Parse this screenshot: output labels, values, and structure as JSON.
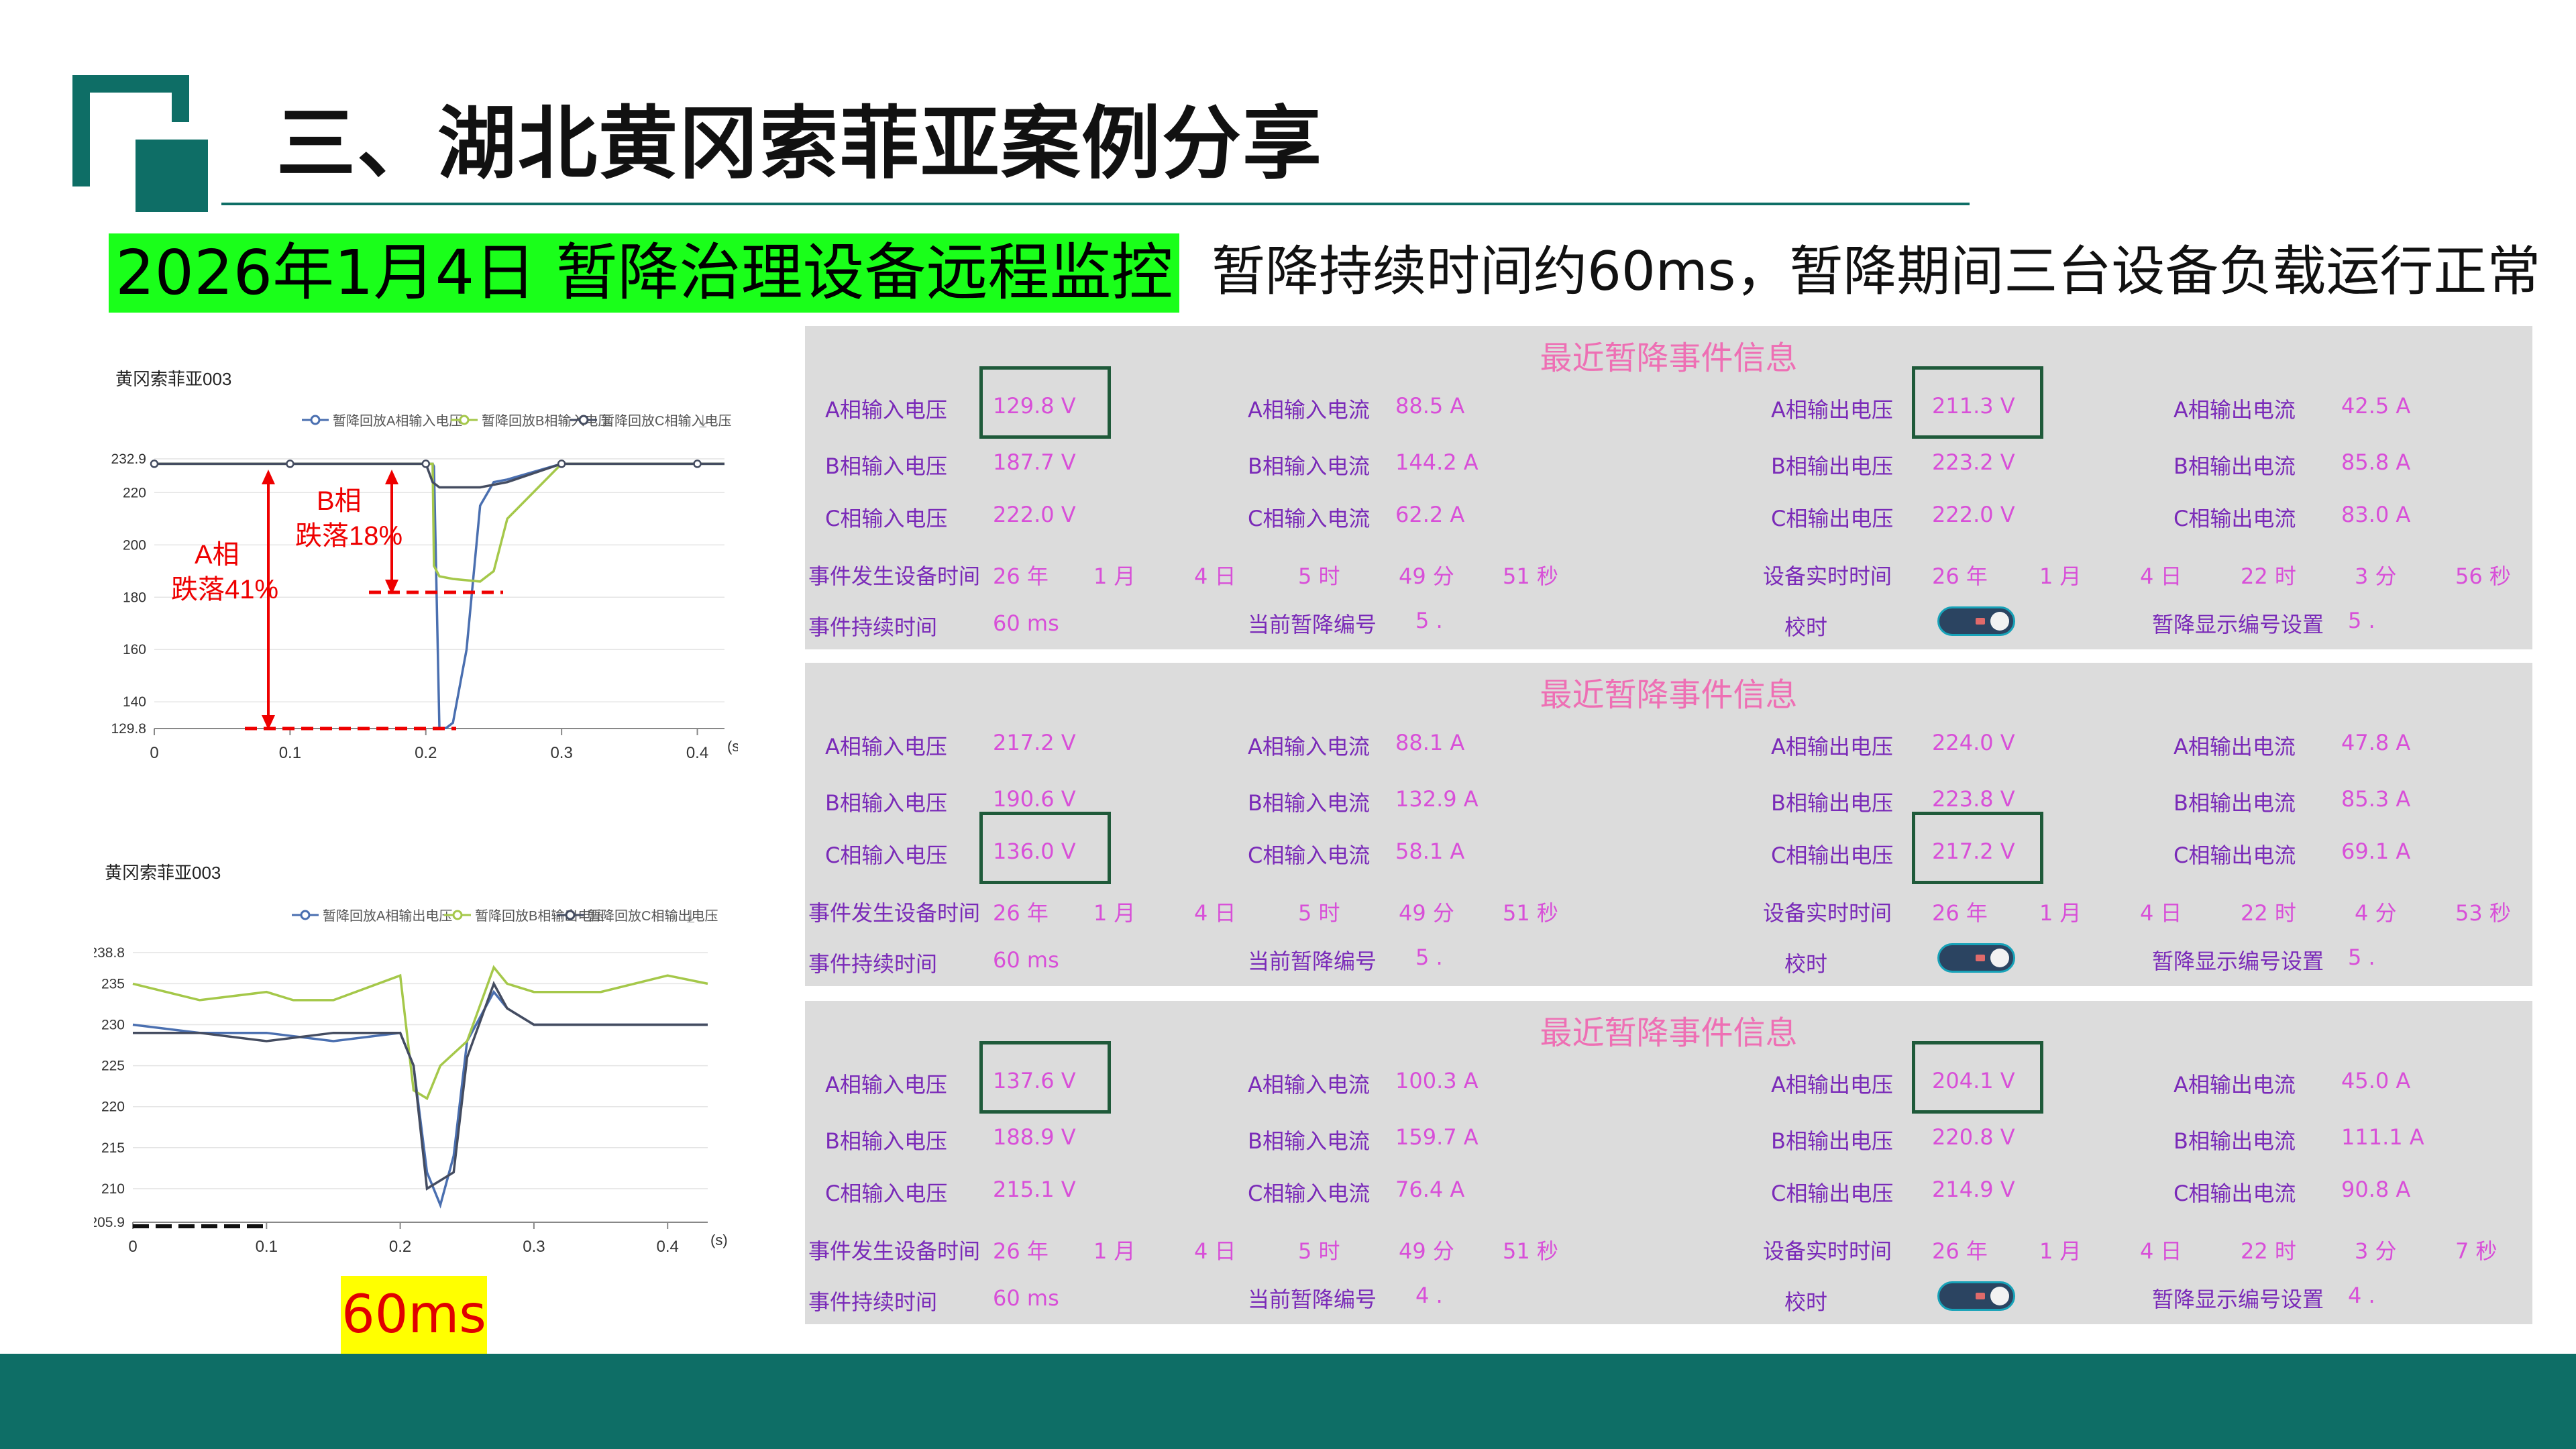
{
  "header": {
    "title": "三、湖北黄冈索菲亚案例分享",
    "subtitle": "2026年1月4日 暂降治理设备远程监控",
    "note": "暂降持续时间约60ms，暂降期间三台设备负载运行正常"
  },
  "colors": {
    "accent": "#0e6e66",
    "subtitle_bg": "#1aff1a",
    "label": "#7a2ab8",
    "value": "#d84fd8",
    "panel_title": "#ee6fb4"
  },
  "chart1": {
    "title": "黄冈索菲亚003",
    "legend": [
      "暂降回放A相输入电压",
      "暂降回放B相输入电压",
      "暂降回放C相输入电压"
    ],
    "y_ticks": [
      "232.9",
      "220",
      "200",
      "180",
      "160",
      "140",
      "129.8"
    ],
    "x_ticks": [
      "0",
      "0.1",
      "0.2",
      "0.3",
      "0.4",
      "(s)"
    ],
    "annot_a": [
      "A相",
      "跌落41%"
    ],
    "annot_b": [
      "B相",
      "跌落18%"
    ]
  },
  "chart2": {
    "title": "黄冈索菲亚003",
    "legend": [
      "暂降回放A相输出电压",
      "暂降回放B相输出电压",
      "暂降回放C相输出电压"
    ],
    "y_ticks": [
      "238.8",
      "235",
      "230",
      "225",
      "220",
      "215",
      "210",
      "205.9"
    ],
    "x_ticks": [
      "0",
      "0.1",
      "0.2",
      "0.3",
      "0.4",
      "(s)"
    ]
  },
  "duration_label": "60ms",
  "chart_data": [
    {
      "type": "line",
      "title": "黄冈索菲亚003",
      "xlabel": "(s)",
      "ylim": [
        129.8,
        232.9
      ],
      "xlim": [
        0,
        0.42
      ],
      "series": [
        {
          "name": "暂降回放A相输入电压",
          "x": [
            0,
            0.1,
            0.2,
            0.205,
            0.206,
            0.21,
            0.215,
            0.22,
            0.23,
            0.24,
            0.25,
            0.26,
            0.3,
            0.42
          ],
          "y": [
            231,
            231,
            231,
            231,
            230,
            130,
            130,
            132,
            160,
            215,
            224,
            225,
            231,
            231
          ]
        },
        {
          "name": "暂降回放B相输入电压",
          "x": [
            0,
            0.1,
            0.2,
            0.205,
            0.206,
            0.21,
            0.22,
            0.24,
            0.25,
            0.26,
            0.3,
            0.42
          ],
          "y": [
            231,
            231,
            231,
            231,
            192,
            188,
            187,
            186,
            190,
            210,
            231,
            231
          ]
        },
        {
          "name": "暂降回放C相输入电压",
          "x": [
            0,
            0.1,
            0.2,
            0.205,
            0.21,
            0.22,
            0.24,
            0.26,
            0.3,
            0.42
          ],
          "y": [
            231,
            231,
            231,
            224,
            222,
            222,
            222,
            224,
            231,
            231
          ]
        }
      ]
    },
    {
      "type": "line",
      "title": "黄冈索菲亚003",
      "xlabel": "(s)",
      "ylim": [
        205.9,
        238.8
      ],
      "xlim": [
        0,
        0.43
      ],
      "series": [
        {
          "name": "暂降回放A相输出电压",
          "x": [
            0,
            0.05,
            0.1,
            0.15,
            0.2,
            0.21,
            0.22,
            0.23,
            0.24,
            0.25,
            0.27,
            0.28,
            0.3,
            0.35,
            0.4,
            0.43
          ],
          "y": [
            230,
            229,
            229,
            228,
            229,
            225,
            212,
            208,
            214,
            228,
            234,
            232,
            230,
            230,
            230,
            230
          ]
        },
        {
          "name": "暂降回放B相输出电压",
          "x": [
            0,
            0.05,
            0.1,
            0.12,
            0.15,
            0.2,
            0.21,
            0.22,
            0.23,
            0.25,
            0.27,
            0.28,
            0.3,
            0.35,
            0.4,
            0.43
          ],
          "y": [
            235,
            233,
            234,
            233,
            233,
            236,
            222,
            221,
            225,
            228,
            237,
            235,
            234,
            234,
            236,
            235
          ]
        },
        {
          "name": "暂降回放C相输出电压",
          "x": [
            0,
            0.05,
            0.1,
            0.15,
            0.2,
            0.21,
            0.22,
            0.23,
            0.24,
            0.25,
            0.27,
            0.28,
            0.3,
            0.35,
            0.4,
            0.43
          ],
          "y": [
            229,
            229,
            228,
            229,
            229,
            225,
            210,
            211,
            212,
            226,
            235,
            232,
            230,
            230,
            230,
            230
          ]
        }
      ]
    }
  ],
  "panels": [
    {
      "title": "最近暂降事件信息",
      "rows": [
        [
          "A相输入电压",
          "129.8 V",
          "A相输入电流",
          "88.5 A",
          "A相输出电压",
          "211.3 V",
          "A相输出电流",
          "42.5 A"
        ],
        [
          "B相输入电压",
          "187.7 V",
          "B相输入电流",
          "144.2 A",
          "B相输出电压",
          "223.2 V",
          "B相输出电流",
          "85.8 A"
        ],
        [
          "C相输入电压",
          "222.0 V",
          "C相输入电流",
          "62.2 A",
          "C相输出电压",
          "222.0 V",
          "C相输出电流",
          "83.0 A"
        ]
      ],
      "event_label": "事件发生设备时间",
      "event_time": [
        "26 年",
        "1 月",
        "4 日",
        "5 时",
        "49 分",
        "51 秒"
      ],
      "rt_label": "设备实时时间",
      "rt_time": [
        "26 年",
        "1 月",
        "4 日",
        "22 时",
        "3 分",
        "56 秒"
      ],
      "dur_label": "事件持续时间",
      "dur_val": "60 ms",
      "cur_label": "当前暂降编号",
      "cur_val": "5 .",
      "cal_label": "校时",
      "disp_label": "暂降显示编号设置",
      "disp_val": "5 ."
    },
    {
      "title": "最近暂降事件信息",
      "rows": [
        [
          "A相输入电压",
          "217.2 V",
          "A相输入电流",
          "88.1 A",
          "A相输出电压",
          "224.0 V",
          "A相输出电流",
          "47.8 A"
        ],
        [
          "B相输入电压",
          "190.6 V",
          "B相输入电流",
          "132.9 A",
          "B相输出电压",
          "223.8 V",
          "B相输出电流",
          "85.3 A"
        ],
        [
          "C相输入电压",
          "136.0 V",
          "C相输入电流",
          "58.1 A",
          "C相输出电压",
          "217.2 V",
          "C相输出电流",
          "69.1 A"
        ]
      ],
      "event_label": "事件发生设备时间",
      "event_time": [
        "26 年",
        "1 月",
        "4 日",
        "5 时",
        "49 分",
        "51 秒"
      ],
      "rt_label": "设备实时时间",
      "rt_time": [
        "26 年",
        "1 月",
        "4 日",
        "22 时",
        "4 分",
        "53 秒"
      ],
      "dur_label": "事件持续时间",
      "dur_val": "60 ms",
      "cur_label": "当前暂降编号",
      "cur_val": "5 .",
      "cal_label": "校时",
      "disp_label": "暂降显示编号设置",
      "disp_val": "5 ."
    },
    {
      "title": "最近暂降事件信息",
      "rows": [
        [
          "A相输入电压",
          "137.6 V",
          "A相输入电流",
          "100.3 A",
          "A相输出电压",
          "204.1 V",
          "A相输出电流",
          "45.0 A"
        ],
        [
          "B相输入电压",
          "188.9 V",
          "B相输入电流",
          "159.7 A",
          "B相输出电压",
          "220.8 V",
          "B相输出电流",
          "111.1 A"
        ],
        [
          "C相输入电压",
          "215.1 V",
          "C相输入电流",
          "76.4 A",
          "C相输出电压",
          "214.9 V",
          "C相输出电流",
          "90.8 A"
        ]
      ],
      "event_label": "事件发生设备时间",
      "event_time": [
        "26 年",
        "1 月",
        "4 日",
        "5 时",
        "49 分",
        "51 秒"
      ],
      "rt_label": "设备实时时间",
      "rt_time": [
        "26 年",
        "1 月",
        "4 日",
        "22 时",
        "3 分",
        "7 秒"
      ],
      "dur_label": "事件持续时间",
      "dur_val": "60 ms",
      "cur_label": "当前暂降编号",
      "cur_val": "4 .",
      "cal_label": "校时",
      "disp_label": "暂降显示编号设置",
      "disp_val": "4 ."
    }
  ]
}
